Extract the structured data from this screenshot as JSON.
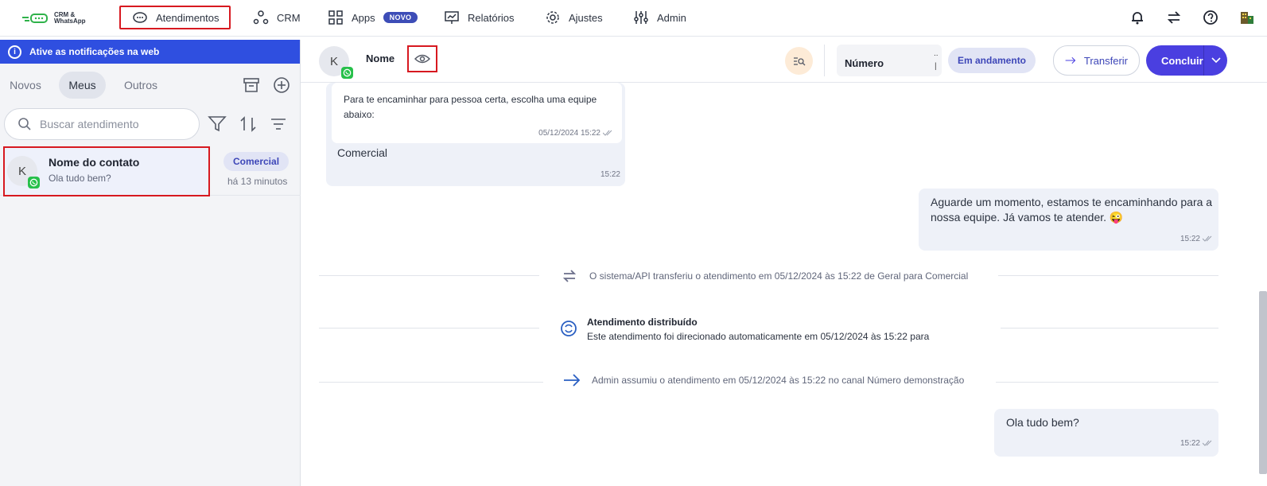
{
  "app": {
    "logo_text_1": "CRM &",
    "logo_text_2": "WhatsApp",
    "brand_color": "#4a3fe0"
  },
  "nav": {
    "items": [
      {
        "label": "Atendimentos",
        "icon": "chat-icon"
      },
      {
        "label": "CRM",
        "icon": "nodes-icon"
      },
      {
        "label": "Apps",
        "icon": "grid-icon",
        "badge": "NOVO"
      },
      {
        "label": "Relatórios",
        "icon": "chart-icon"
      },
      {
        "label": "Ajustes",
        "icon": "gear-icon"
      },
      {
        "label": "Admin",
        "icon": "sliders-icon"
      }
    ]
  },
  "notification_banner": "Ative as notificações na web",
  "tabs": [
    "Novos",
    "Meus",
    "Outros"
  ],
  "search": {
    "placeholder": "Buscar atendimento"
  },
  "contact": {
    "avatar_letter": "K",
    "name": "Nome do contato",
    "preview": "Ola tudo bem?",
    "tag": "Comercial",
    "time_ago": "há 13 minutos"
  },
  "chat_header": {
    "avatar_letter": "K",
    "name": "Nome",
    "number_label": "Número",
    "number_extra_top": "..",
    "number_extra_bottom": "|",
    "status": "Em andamento",
    "transfer_label": "Transferir",
    "conclude_label": "Concluir"
  },
  "messages": {
    "quoted_text": "Para te encaminhar para pessoa certa, escolha uma equipe abaixo:",
    "quoted_time": "05/12/2024 15:22",
    "reply_text": "Comercial",
    "reply_time": "15:22",
    "outgoing_1": "Aguarde um momento, estamos te encaminhando para a nossa equipe. Já vamos te atender. 😜",
    "outgoing_1_time": "15:22",
    "system_transfer": "O sistema/API transferiu o atendimento em 05/12/2024 às 15:22 de Geral para Comercial",
    "system_distributed_title": "Atendimento distribuído",
    "system_distributed_text": "Este atendimento foi direcionado automaticamente em 05/12/2024 às 15:22 para",
    "system_admin": "Admin assumiu o atendimento em 05/12/2024 às 15:22 no canal Número demonstração",
    "outgoing_2": "Ola tudo bem?",
    "outgoing_2_time": "15:22"
  }
}
